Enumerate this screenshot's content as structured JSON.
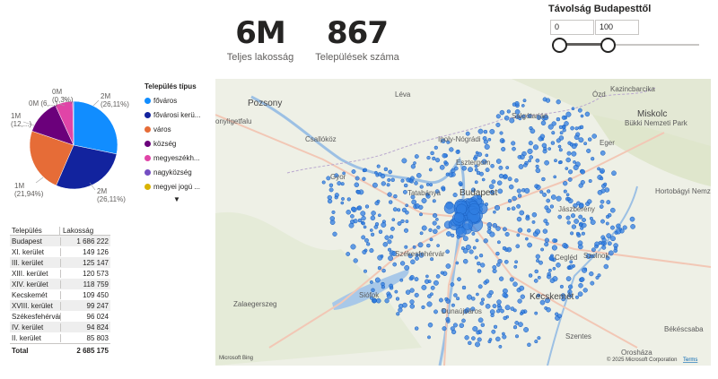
{
  "kpis": [
    {
      "value": "6M",
      "label": "Teljes lakosság"
    },
    {
      "value": "867",
      "label": "Települések száma"
    }
  ],
  "slicer": {
    "title": "Távolság Budapesttől",
    "min": "0",
    "max": "100"
  },
  "pie": {
    "labels": [
      {
        "line1": "2M",
        "line2": "(26,11%)"
      },
      {
        "line1": "2M",
        "line2": "(26,11%)"
      },
      {
        "line1": "1M",
        "line2": "(21,94%)"
      },
      {
        "line1": "1M",
        "line2": "(12,...)"
      },
      {
        "line1": "0M (6,...)",
        "line2": ""
      },
      {
        "line1": "0M",
        "line2": "(0,3%)"
      }
    ]
  },
  "chart_data": {
    "type": "pie",
    "categories": [
      "főváros",
      "fővárosi kerü...",
      "város",
      "község",
      "megyeszékh...",
      "nagyközség",
      "megyei jogú ..."
    ],
    "values": [
      26.11,
      26.11,
      21.94,
      12.0,
      6.0,
      0.3,
      0.0
    ],
    "colors": [
      "#118dff",
      "#12239e",
      "#e66c37",
      "#6b007b",
      "#e044a7",
      "#744ec2",
      "#d9b300"
    ],
    "legend_title": "Település típus"
  },
  "legend": {
    "title": "Település típus",
    "items": [
      {
        "label": "főváros",
        "color": "#118dff"
      },
      {
        "label": "fővárosi kerü...",
        "color": "#12239e"
      },
      {
        "label": "város",
        "color": "#e66c37"
      },
      {
        "label": "község",
        "color": "#6b007b"
      },
      {
        "label": "megyeszékh...",
        "color": "#e044a7"
      },
      {
        "label": "nagyközség",
        "color": "#744ec2"
      },
      {
        "label": "megyei jogú ...",
        "color": "#d9b300"
      }
    ],
    "more": "▼"
  },
  "table": {
    "headers": [
      "Település",
      "Lakosság"
    ],
    "rows": [
      [
        "Budapest",
        "1 686 222"
      ],
      [
        "XI. kerület",
        "149 126"
      ],
      [
        "III. kerület",
        "125 147"
      ],
      [
        "XIII. kerület",
        "120 573"
      ],
      [
        "XIV. kerület",
        "118 759"
      ],
      [
        "Kecskemét",
        "109 450"
      ],
      [
        "XVIII. kerület",
        "99 247"
      ],
      [
        "Székesfehérvár",
        "96 024"
      ],
      [
        "IV. kerület",
        "94 824"
      ],
      [
        "II. kerület",
        "85 803"
      ]
    ],
    "total_label": "Total",
    "total_value": "2 685 175"
  },
  "map": {
    "cities": [
      "Pozsony",
      "Léva",
      "Ózd",
      "Kazincbarcika",
      "Miskolc",
      "Salgótarján",
      "Eger",
      "Gyor",
      "Budapest",
      "Jászberény",
      "Szolnok",
      "Cegléd",
      "Székesfehérvár",
      "Siófok",
      "Dunaújváros",
      "Kecskemét",
      "Szentes",
      "Zalaegerszeg",
      "Orosháza",
      "Békéscsaba",
      "Csallóköz",
      "Ipoly-Nógrádi",
      "Bükki Nemzeti Park",
      "Hortobágyi Nemzeti Park",
      "onyligetfalu",
      "Tatabánya",
      "Esztergom"
    ],
    "attribution": "© 2025 Microsoft Corporation",
    "terms": "Terms",
    "logo": "Microsoft Bing"
  }
}
